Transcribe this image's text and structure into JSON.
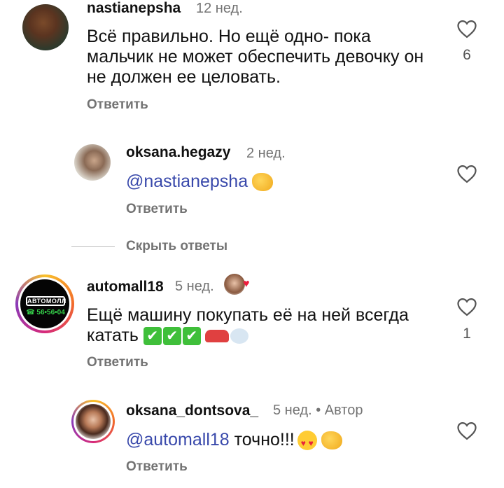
{
  "comments": [
    {
      "username": "nastianepsha",
      "time": "12 нед.",
      "text": "Всё правильно. Но ещё одно- пока мальчик не может обеспечить девочку он не должен ее целовать.",
      "reply_label": "Ответить",
      "likes": "6"
    },
    {
      "username": "oksana.hegazy",
      "time": "2 нед.",
      "mention": "@nastianepsha",
      "reply_label": "Ответить"
    },
    {
      "username": "automall18",
      "time": "5 нед.",
      "text": "Ещё машину покупать её на ней всегда катать",
      "reply_label": "Ответить",
      "likes": "1",
      "avatar_logo": "АВТОМОЛЛ",
      "avatar_phone": "☎ 56•56•04"
    },
    {
      "username": "oksana_dontsova_",
      "time": "5 нед. • Автор",
      "mention": "@automall18",
      "text": "точно!!!",
      "reply_label": "Ответить"
    }
  ],
  "hide_replies_label": "Скрыть ответы",
  "icons": {
    "like": "heart-outline-icon",
    "checks": [
      "✔",
      "✔",
      "✔"
    ]
  },
  "colors": {
    "mention": "#3949ab",
    "muted": "#737373",
    "heart_badge": "#ee1d3d"
  }
}
